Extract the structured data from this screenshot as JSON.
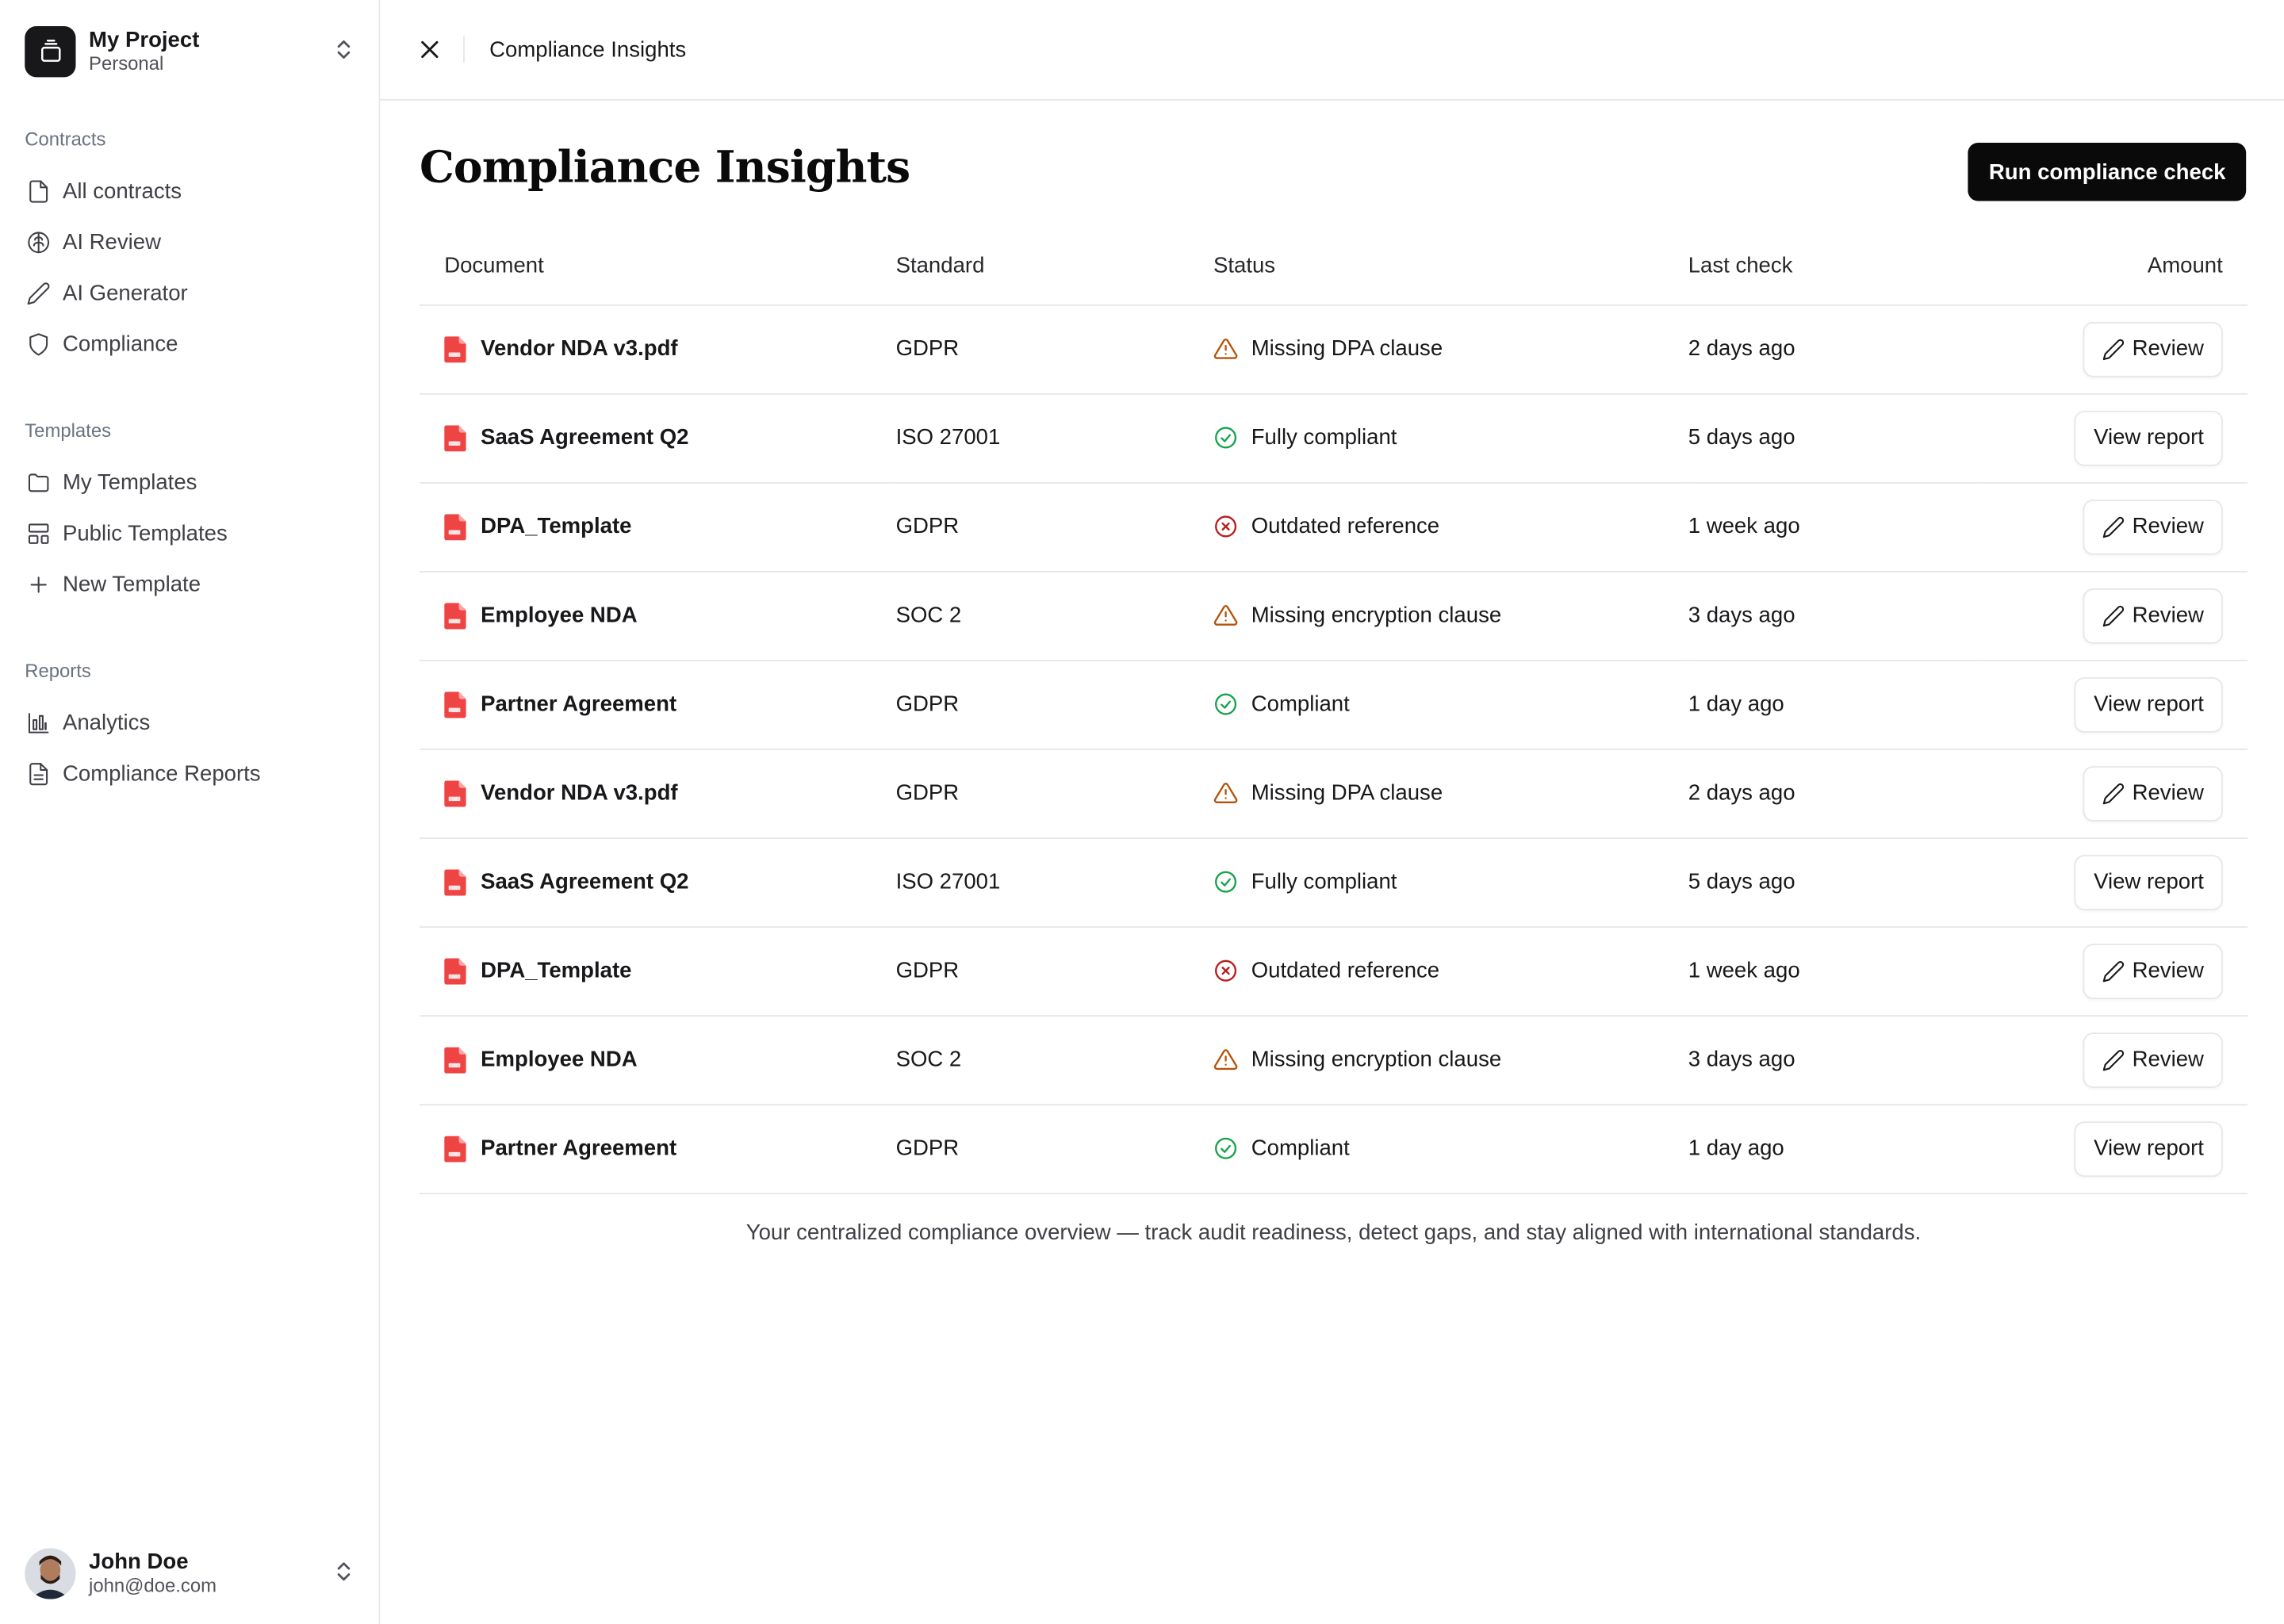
{
  "project": {
    "name": "My Project",
    "subtitle": "Personal"
  },
  "nav": {
    "contracts": {
      "heading": "Contracts",
      "items": [
        {
          "label": "All contracts",
          "icon": "file-icon"
        },
        {
          "label": "AI Review",
          "icon": "brain-icon"
        },
        {
          "label": "AI Generator",
          "icon": "pen-icon"
        },
        {
          "label": "Compliance",
          "icon": "shield-icon"
        }
      ]
    },
    "templates": {
      "heading": "Templates",
      "items": [
        {
          "label": "My Templates",
          "icon": "folder-icon"
        },
        {
          "label": "Public Templates",
          "icon": "layout-icon"
        },
        {
          "label": "New Template",
          "icon": "plus-icon"
        }
      ]
    },
    "reports": {
      "heading": "Reports",
      "items": [
        {
          "label": "Analytics",
          "icon": "bar-chart-icon"
        },
        {
          "label": "Compliance Reports",
          "icon": "file-text-icon"
        }
      ]
    }
  },
  "user": {
    "name": "John Doe",
    "email": "john@doe.com"
  },
  "topbar": {
    "title": "Compliance Insights"
  },
  "page": {
    "title": "Compliance Insights",
    "run_button": "Run compliance check"
  },
  "table": {
    "headers": {
      "document": "Document",
      "standard": "Standard",
      "status": "Status",
      "last_check": "Last check",
      "amount": "Amount"
    },
    "rows": [
      {
        "document": "Vendor NDA v3.pdf",
        "standard": "GDPR",
        "status": "Missing DPA clause",
        "status_type": "warning",
        "last_check": "2 days ago",
        "action": "Review"
      },
      {
        "document": "SaaS Agreement Q2",
        "standard": "ISO 27001",
        "status": "Fully compliant",
        "status_type": "success",
        "last_check": "5 days ago",
        "action": "View report"
      },
      {
        "document": "DPA_Template",
        "standard": "GDPR",
        "status": "Outdated reference",
        "status_type": "error",
        "last_check": "1 week ago",
        "action": "Review"
      },
      {
        "document": "Employee NDA",
        "standard": "SOC 2",
        "status": "Missing encryption clause",
        "status_type": "warning",
        "last_check": "3 days ago",
        "action": "Review"
      },
      {
        "document": "Partner Agreement",
        "standard": "GDPR",
        "status": "Compliant",
        "status_type": "success",
        "last_check": "1 day ago",
        "action": "View report"
      },
      {
        "document": "Vendor NDA v3.pdf",
        "standard": "GDPR",
        "status": "Missing DPA clause",
        "status_type": "warning",
        "last_check": "2 days ago",
        "action": "Review"
      },
      {
        "document": "SaaS Agreement Q2",
        "standard": "ISO 27001",
        "status": "Fully compliant",
        "status_type": "success",
        "last_check": "5 days ago",
        "action": "View report"
      },
      {
        "document": "DPA_Template",
        "standard": "GDPR",
        "status": "Outdated reference",
        "status_type": "error",
        "last_check": "1 week ago",
        "action": "Review"
      },
      {
        "document": "Employee NDA",
        "standard": "SOC 2",
        "status": "Missing encryption clause",
        "status_type": "warning",
        "last_check": "3 days ago",
        "action": "Review"
      },
      {
        "document": "Partner Agreement",
        "standard": "GDPR",
        "status": "Compliant",
        "status_type": "success",
        "last_check": "1 day ago",
        "action": "View report"
      }
    ]
  },
  "caption": "Your centralized compliance overview — track audit readiness, detect gaps, and stay aligned with international standards.",
  "colors": {
    "warning": "#b45309",
    "success": "#16a34a",
    "error": "#b91c1c",
    "pdf": "#ef4444",
    "primary": "#0a0a0a"
  }
}
